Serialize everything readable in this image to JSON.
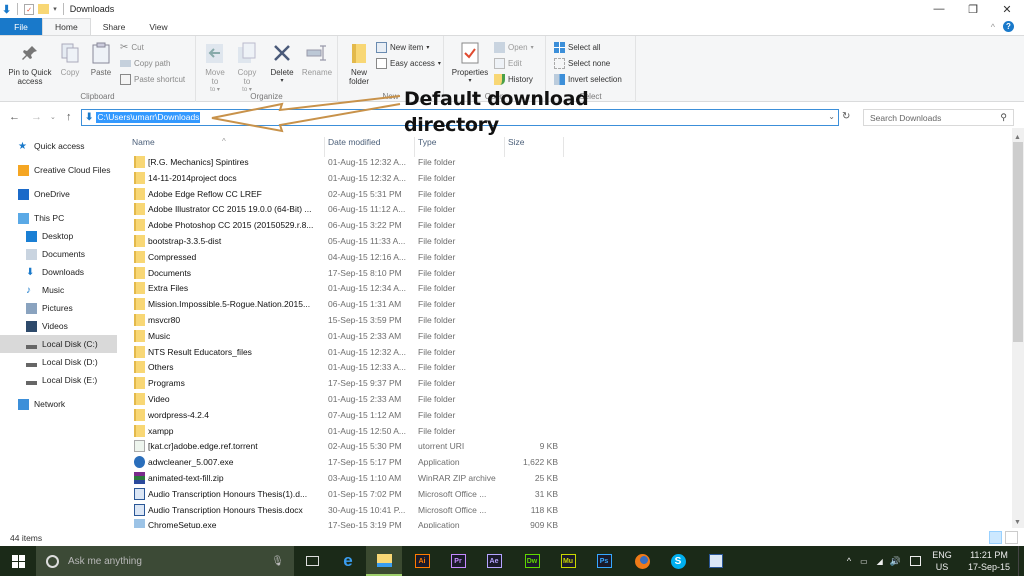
{
  "window": {
    "title": "Downloads",
    "controls": {
      "minimize": "—",
      "maximize": "❐",
      "close": "✕"
    }
  },
  "ribbon_tabs": [
    {
      "label": "File"
    },
    {
      "label": "Home"
    },
    {
      "label": "Share"
    },
    {
      "label": "View"
    }
  ],
  "ribbon": {
    "clipboard": {
      "group_label": "Clipboard",
      "pin": "Pin to Quick access",
      "copy": "Copy",
      "paste": "Paste",
      "cut": "Cut",
      "copy_path": "Copy path",
      "paste_shortcut": "Paste shortcut"
    },
    "organize": {
      "group_label": "Organize",
      "move_to": "Move to",
      "copy_to": "Copy to",
      "delete": "Delete",
      "rename": "Rename"
    },
    "new": {
      "group_label": "New",
      "new_folder": "New folder",
      "new_item": "New item",
      "easy_access": "Easy access"
    },
    "open": {
      "group_label": "Open",
      "properties": "Properties",
      "open": "Open",
      "edit": "Edit",
      "history": "History"
    },
    "select": {
      "group_label": "Select",
      "select_all": "Select all",
      "select_none": "Select none",
      "invert": "Invert selection"
    }
  },
  "address": {
    "path": "C:\\Users\\umarr\\Downloads",
    "search_placeholder": "Search Downloads"
  },
  "annotation": {
    "line1": "Default download",
    "line2": "directory",
    "color": "#c8924a"
  },
  "nav": [
    {
      "label": "Quick access",
      "icon": "star-icon"
    },
    {
      "label": "Creative Cloud Files",
      "icon": "creative-cloud-icon"
    },
    {
      "label": "OneDrive",
      "icon": "cloud-icon"
    },
    {
      "label": "This PC",
      "icon": "computer-icon"
    },
    {
      "label": "Desktop",
      "icon": "desktop-icon"
    },
    {
      "label": "Documents",
      "icon": "documents-icon"
    },
    {
      "label": "Downloads",
      "icon": "download-icon"
    },
    {
      "label": "Music",
      "icon": "music-icon"
    },
    {
      "label": "Pictures",
      "icon": "pictures-icon"
    },
    {
      "label": "Videos",
      "icon": "videos-icon"
    },
    {
      "label": "Local Disk (C:)",
      "icon": "drive-icon",
      "selected": true
    },
    {
      "label": "Local Disk (D:)",
      "icon": "drive-icon"
    },
    {
      "label": "Local Disk (E:)",
      "icon": "drive-icon"
    },
    {
      "label": "Network",
      "icon": "network-icon"
    }
  ],
  "columns": {
    "name": "Name",
    "date": "Date modified",
    "type": "Type",
    "size": "Size"
  },
  "files": [
    {
      "name": "[R.G. Mechanics] Spintires",
      "date": "01-Aug-15 12:32 A...",
      "type": "File folder",
      "size": "",
      "kind": "folder"
    },
    {
      "name": "14-11-2014project docs",
      "date": "01-Aug-15 12:32 A...",
      "type": "File folder",
      "size": "",
      "kind": "folder"
    },
    {
      "name": "Adobe Edge Reflow CC LREF",
      "date": "02-Aug-15 5:31 PM",
      "type": "File folder",
      "size": "",
      "kind": "folder"
    },
    {
      "name": "Adobe Illustrator CC 2015 19.0.0 (64-Bit) ...",
      "date": "06-Aug-15 11:12 A...",
      "type": "File folder",
      "size": "",
      "kind": "folder"
    },
    {
      "name": "Adobe Photoshop CC 2015 (20150529.r.8...",
      "date": "06-Aug-15 3:22 PM",
      "type": "File folder",
      "size": "",
      "kind": "folder"
    },
    {
      "name": "bootstrap-3.3.5-dist",
      "date": "05-Aug-15 11:33 A...",
      "type": "File folder",
      "size": "",
      "kind": "folder"
    },
    {
      "name": "Compressed",
      "date": "04-Aug-15 12:16 A...",
      "type": "File folder",
      "size": "",
      "kind": "folder"
    },
    {
      "name": "Documents",
      "date": "17-Sep-15 8:10 PM",
      "type": "File folder",
      "size": "",
      "kind": "folder"
    },
    {
      "name": "Extra Files",
      "date": "01-Aug-15 12:34 A...",
      "type": "File folder",
      "size": "",
      "kind": "folder"
    },
    {
      "name": "Mission.Impossible.5-Rogue.Nation.2015...",
      "date": "06-Aug-15 1:31 AM",
      "type": "File folder",
      "size": "",
      "kind": "folder"
    },
    {
      "name": "msvcr80",
      "date": "15-Sep-15 3:59 PM",
      "type": "File folder",
      "size": "",
      "kind": "folder"
    },
    {
      "name": "Music",
      "date": "01-Aug-15 2:33 AM",
      "type": "File folder",
      "size": "",
      "kind": "folder"
    },
    {
      "name": "NTS Result Educators_files",
      "date": "01-Aug-15 12:32 A...",
      "type": "File folder",
      "size": "",
      "kind": "folder"
    },
    {
      "name": "Others",
      "date": "01-Aug-15 12:33 A...",
      "type": "File folder",
      "size": "",
      "kind": "folder"
    },
    {
      "name": "Programs",
      "date": "17-Sep-15 9:37 PM",
      "type": "File folder",
      "size": "",
      "kind": "folder"
    },
    {
      "name": "Video",
      "date": "01-Aug-15 2:33 AM",
      "type": "File folder",
      "size": "",
      "kind": "folder"
    },
    {
      "name": "wordpress-4.2.4",
      "date": "07-Aug-15 1:12 AM",
      "type": "File folder",
      "size": "",
      "kind": "folder"
    },
    {
      "name": "xampp",
      "date": "01-Aug-15 12:50 A...",
      "type": "File folder",
      "size": "",
      "kind": "folder"
    },
    {
      "name": "[kat.cr]adobe.edge.ref.torrent",
      "date": "02-Aug-15 5:30 PM",
      "type": "utorrent URI",
      "size": "9 KB",
      "kind": "torrent"
    },
    {
      "name": "adwcleaner_5.007.exe",
      "date": "17-Sep-15 5:17 PM",
      "type": "Application",
      "size": "1,622 KB",
      "kind": "exe"
    },
    {
      "name": "animated-text-fill.zip",
      "date": "03-Aug-15 1:10 AM",
      "type": "WinRAR ZIP archive",
      "size": "25 KB",
      "kind": "zip"
    },
    {
      "name": "Audio Transcription Honours Thesis(1).d...",
      "date": "01-Sep-15 7:02 PM",
      "type": "Microsoft Office ...",
      "size": "31 KB",
      "kind": "doc"
    },
    {
      "name": "Audio Transcription Honours Thesis.docx",
      "date": "30-Aug-15 10:41 P...",
      "type": "Microsoft Office ...",
      "size": "118 KB",
      "kind": "doc"
    },
    {
      "name": "ChromeSetup.exe",
      "date": "17-Sep-15 3:19 PM",
      "type": "Application",
      "size": "909 KB",
      "kind": "setup"
    }
  ],
  "status": {
    "item_count": "44 items"
  },
  "taskbar": {
    "search_placeholder": "Ask me anything",
    "apps": [
      {
        "name": "task-view"
      },
      {
        "name": "edge"
      },
      {
        "name": "file-explorer",
        "active": true
      },
      {
        "name": "illustrator",
        "label": "Ai",
        "color": "#ff7c00"
      },
      {
        "name": "premiere",
        "label": "Pr",
        "color": "#c58bff"
      },
      {
        "name": "after-effects",
        "label": "Ae",
        "color": "#b5a5ff"
      },
      {
        "name": "dreamweaver",
        "label": "Dw",
        "color": "#60d700"
      },
      {
        "name": "muse",
        "label": "Mu",
        "color": "#c9d700"
      },
      {
        "name": "photoshop",
        "label": "Ps",
        "color": "#36a8ff"
      },
      {
        "name": "firefox"
      },
      {
        "name": "skype"
      },
      {
        "name": "word"
      }
    ],
    "lang_top": "ENG",
    "lang_bottom": "US",
    "time": "11:21 PM",
    "date": "17-Sep-15"
  }
}
